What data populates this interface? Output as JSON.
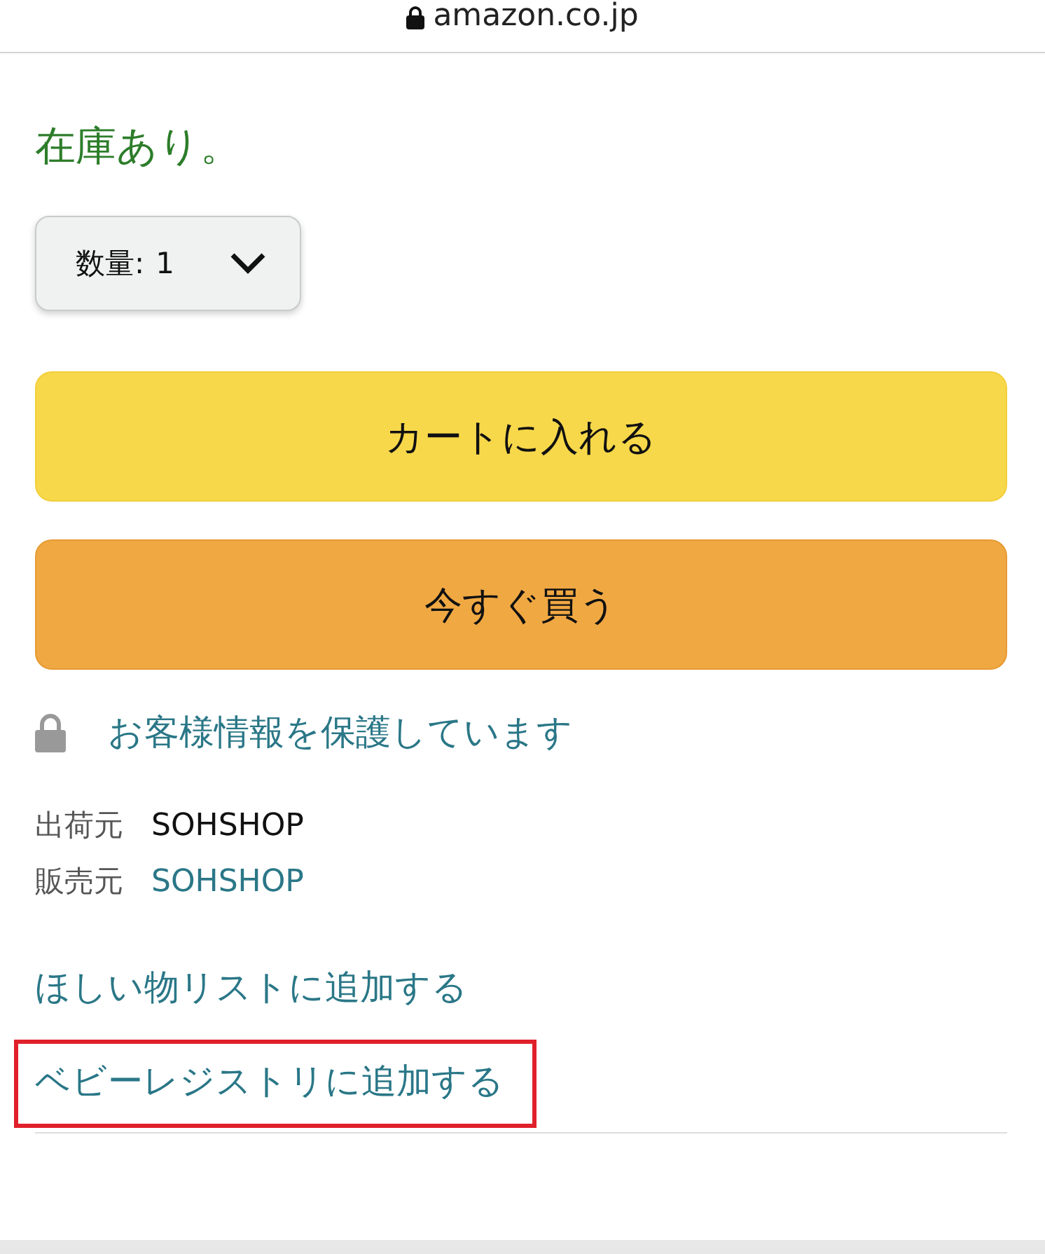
{
  "address_bar": {
    "url": "amazon.co.jp"
  },
  "stock": "在庫あり。",
  "quantity": {
    "label": "数量:",
    "value": "1"
  },
  "buttons": [
    {
      "label": "カートに入れる",
      "kind": "cart"
    },
    {
      "label": "今すぐ買う",
      "kind": "buy"
    }
  ],
  "secure_link": "お客様情報を保護しています",
  "seller_info": [
    {
      "label": "出荷元",
      "value": "SOHSHOP",
      "kind": "text"
    },
    {
      "label": "販売元",
      "value": "SOHSHOP",
      "kind": "link"
    }
  ],
  "actions": [
    {
      "label": "ほしい物リストに追加する",
      "highlighted": false
    },
    {
      "label": "ベビーレジストリに追加する",
      "highlighted": true
    }
  ]
}
